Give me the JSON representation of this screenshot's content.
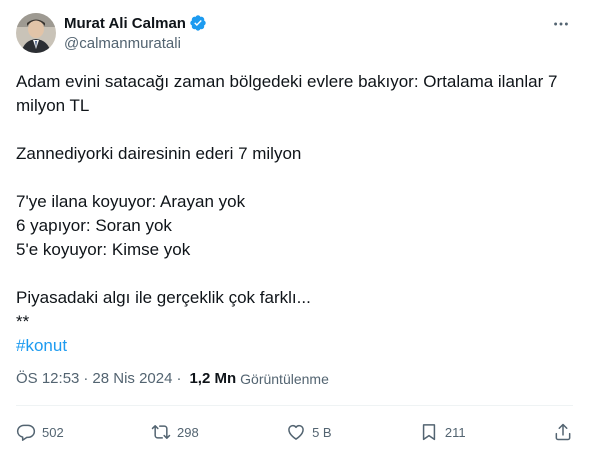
{
  "author": {
    "display_name": "Murat Ali Calman",
    "handle": "@calmanmuratali",
    "verified": true
  },
  "tweet": {
    "lines": [
      "Adam evini satacağı zaman bölgedeki evlere bakıyor: Ortalama ilanlar 7",
      "milyon TL",
      "",
      "Zannediyorki dairesinin ederi 7 milyon",
      "",
      "7'ye ilana koyuyor: Arayan yok",
      "6 yapıyor: Soran yok",
      "5'e koyuyor: Kimse yok",
      "",
      "Piyasadaki algı ile gerçeklik çok farklı...",
      "**"
    ],
    "hashtag": "#konut"
  },
  "meta": {
    "time": "ÖS 12:53",
    "separator": "·",
    "date": "28 Nis 2024",
    "views_count": "1,2 Mn",
    "views_label": "Görüntülenme"
  },
  "actions": {
    "replies": "502",
    "reposts": "298",
    "likes": "5 B",
    "bookmarks": "211"
  },
  "colors": {
    "accent": "#1d9bf0",
    "text": "#0f1419",
    "secondary": "#536471",
    "divider": "#eff3f4"
  },
  "icons": [
    "verified-badge-icon",
    "more-options-icon",
    "reply-icon",
    "repost-icon",
    "like-icon",
    "bookmark-icon",
    "share-icon"
  ]
}
